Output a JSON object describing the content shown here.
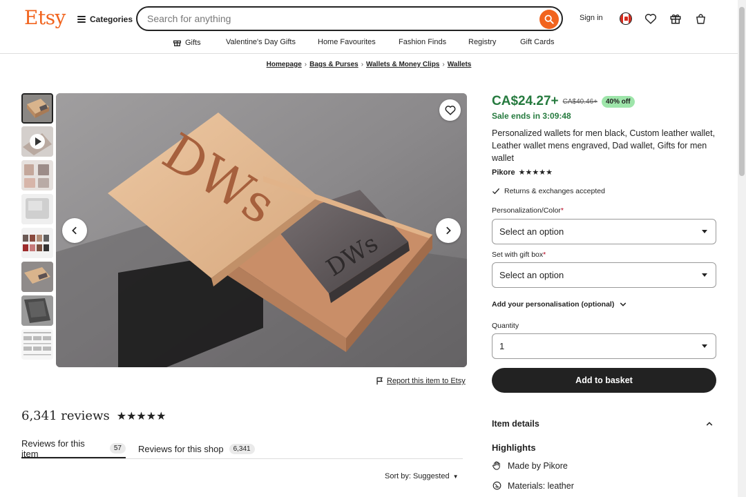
{
  "header": {
    "logo": "Etsy",
    "categories_label": "Categories",
    "search_placeholder": "Search for anything",
    "sign_in": "Sign in",
    "colors": {
      "brand": "#f1641e"
    }
  },
  "subnav": {
    "items": [
      "Gifts",
      "Valentine's Day Gifts",
      "Home Favourites",
      "Fashion Finds",
      "Registry",
      "Gift Cards"
    ]
  },
  "breadcrumb": [
    "Homepage",
    "Bags & Purses",
    "Wallets & Money Clips",
    "Wallets"
  ],
  "gallery": {
    "main_image_text": "DWs",
    "wallet_text": "DWs",
    "report_label": "Report this item to Etsy"
  },
  "reviews": {
    "title": "6,341 reviews",
    "stars": "★★★★★",
    "tab_item_label": "Reviews for this item",
    "tab_item_count": "57",
    "tab_shop_label": "Reviews for this shop",
    "tab_shop_count": "6,341",
    "sort_label": "Sort by: Suggested"
  },
  "product": {
    "price": "CA$24.27+",
    "original_price": "CA$40.46+",
    "discount": "40% off",
    "sale_text": "Sale ends in 3:09:48",
    "title": "Personalized wallets for men black, Custom leather wallet, Leather wallet mens engraved, Dad wallet, Gifts for men wallet",
    "seller": "Pikore",
    "seller_stars": "★★★★★",
    "returns": "Returns & exchanges accepted",
    "personalization_label": "Personalization/Color",
    "personalization_value": "Select an option",
    "giftbox_label": "Set with gift box",
    "giftbox_value": "Select an option",
    "add_personalisation": "Add your personalisation (optional)",
    "quantity_label": "Quantity",
    "quantity_value": "1",
    "add_to_basket": "Add to basket",
    "item_details": "Item details",
    "highlights": "Highlights",
    "made_by_prefix": "Made by",
    "made_by_name": "Pikore",
    "materials": "Materials: leather",
    "colors": {
      "price": "#257a3e",
      "discount_bg": "#9ee5aa",
      "required": "#b3001b"
    }
  }
}
